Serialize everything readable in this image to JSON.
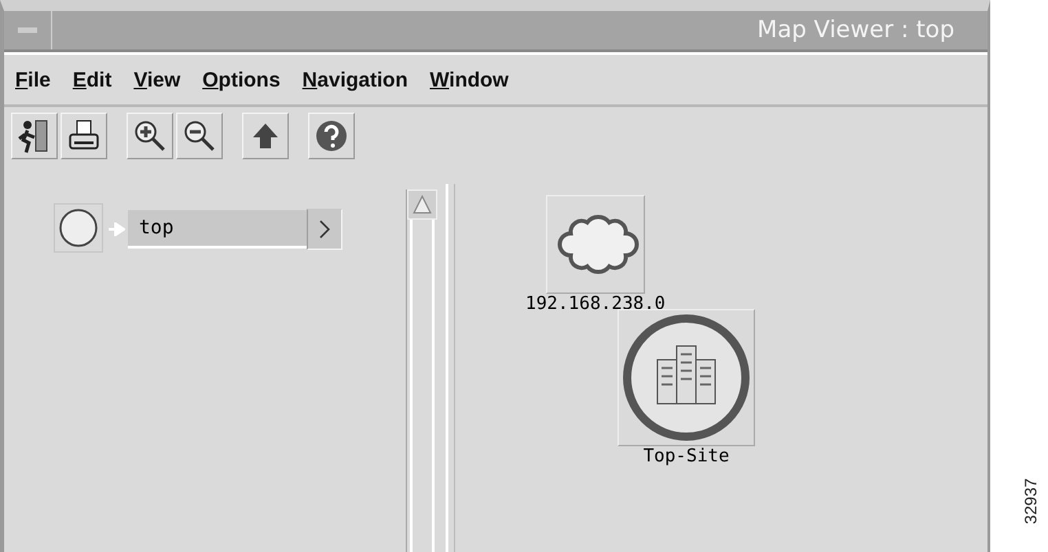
{
  "window": {
    "title": "Map Viewer : top"
  },
  "menu": [
    "File",
    "Edit",
    "View",
    "Options",
    "Navigation",
    "Window"
  ],
  "toolbar": [
    {
      "kind": "exit"
    },
    {
      "kind": "print"
    },
    {
      "kind": "zoom-in"
    },
    {
      "kind": "zoom-out"
    },
    {
      "kind": "up"
    },
    {
      "kind": "help"
    }
  ],
  "tree": {
    "label": "top"
  },
  "map": {
    "nodes": [
      {
        "kind": "network",
        "label": "192.168.238.0"
      },
      {
        "kind": "site",
        "label": "Top-Site"
      }
    ]
  },
  "figure_number": "32937"
}
